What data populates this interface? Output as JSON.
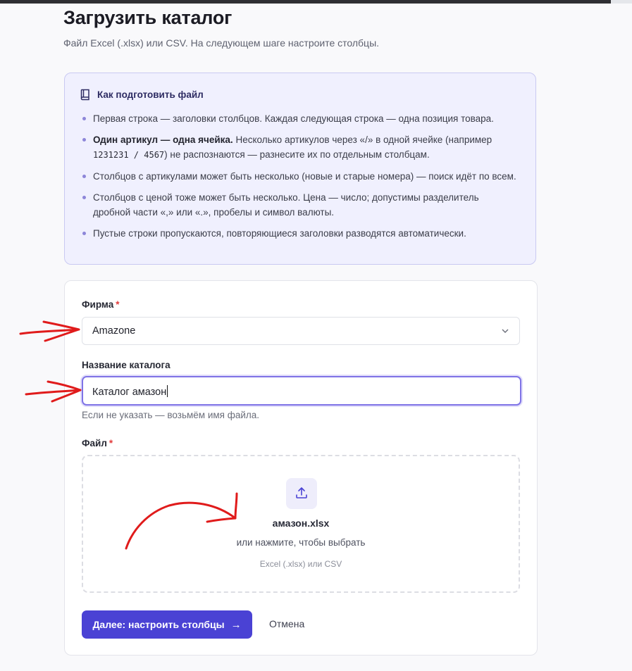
{
  "header": {
    "title": "Загрузить каталог",
    "subtitle": "Файл Excel (.xlsx) или CSV. На следующем шаге настроите столбцы."
  },
  "info": {
    "icon": "book-icon",
    "title": "Как подготовить файл",
    "tip1": "Первая строка — заголовки столбцов. Каждая следующая строка — одна позиция товара.",
    "tip2_bold": "Один артикул — одна ячейка.",
    "tip2_a": " Несколько артикулов через «/» в одной ячейке (например ",
    "tip2_code": "1231231 / 4567",
    "tip2_b": ") не распознаются — разнесите их по отдельным столбцам.",
    "tip3": "Столбцов с артикулами может быть несколько (новые и старые номера) — поиск идёт по всем.",
    "tip4": "Столбцов с ценой тоже может быть несколько. Цена — число; допустимы разделитель дробной части «,» или «.», пробелы и символ валюты.",
    "tip5": "Пустые строки пропускаются, повторяющиеся заголовки разводятся автоматически."
  },
  "form": {
    "required_mark": "*",
    "company_label": "Фирма",
    "company_value": "Amazone",
    "catalog_label": "Название каталога",
    "catalog_value": "Каталог амазон",
    "catalog_hint": "Если не указать — возьмём имя файла.",
    "file_label": "Файл",
    "file_name": "амазон.xlsx",
    "file_pick_hint": "или нажмите, чтобы выбрать",
    "file_formats": "Excel (.xlsx) или CSV",
    "submit_label": "Далее: настроить столбцы",
    "submit_arrow": "→",
    "cancel_label": "Отмена"
  },
  "colors": {
    "accent": "#4a42d4",
    "info_bg": "#f0f0fe",
    "annotation": "#e01b1b",
    "required": "#e23b3b"
  }
}
